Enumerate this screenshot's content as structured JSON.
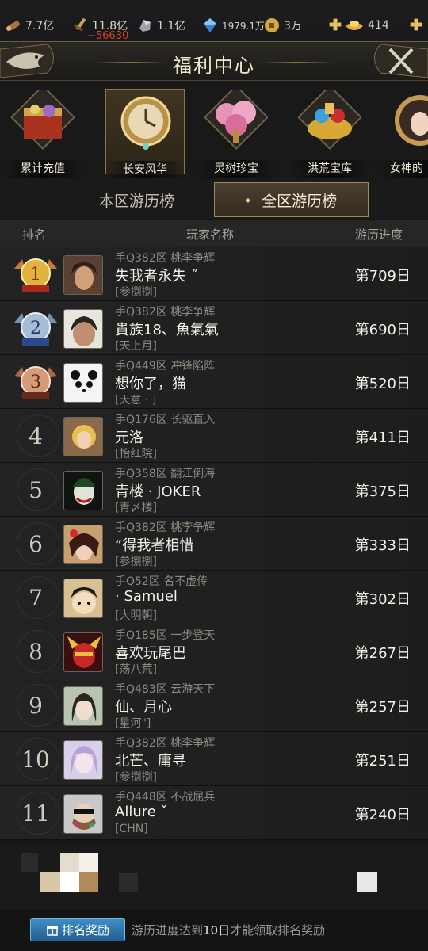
{
  "resources": {
    "wood": "7.7亿",
    "weapon": "11.8亿",
    "weapon_delta": "−56630",
    "iron": "1.1亿",
    "gem": "1979.1万",
    "coin": "3万",
    "ingot": "414"
  },
  "title": "福利中心",
  "categories": [
    {
      "label": "累计充值",
      "icon": "treasure-chest-icon"
    },
    {
      "label": "长安风华",
      "icon": "golden-clock-icon"
    },
    {
      "label": "灵树珍宝",
      "icon": "blossom-tree-icon"
    },
    {
      "label": "洪荒宝库",
      "icon": "treasure-pile-icon"
    },
    {
      "label": "女神的",
      "icon": "goddess-portrait-icon"
    }
  ],
  "tabs": {
    "local": "本区游历榜",
    "global": "全区游历榜"
  },
  "headers": {
    "rank": "排名",
    "player": "玩家名称",
    "progress": "游历进度"
  },
  "rows": [
    {
      "rank": "1",
      "server": "手Q382区  桃李争辉",
      "name": "失我者永失 ˝",
      "guild": "[参捌捌]",
      "progress": "第709日"
    },
    {
      "rank": "2",
      "server": "手Q382区  桃李争辉",
      "name": "貴族18、魚氣氣",
      "guild": "[天上月]",
      "progress": "第690日"
    },
    {
      "rank": "3",
      "server": "手Q449区  冲锋陷阵",
      "name": "想你了，猫",
      "guild": "[天意 · ]",
      "progress": "第520日"
    },
    {
      "rank": "4",
      "server": "手Q176区  长驱直入",
      "name": "元洛",
      "guild": "[怡红院]",
      "progress": "第411日"
    },
    {
      "rank": "5",
      "server": "手Q358区  翻江倒海",
      "name": "青楼 · JOKER",
      "guild": "[青〆楼]",
      "progress": "第375日"
    },
    {
      "rank": "6",
      "server": "手Q382区  桃李争辉",
      "name": "“得我者相惜",
      "guild": "[参捌捌]",
      "progress": "第333日"
    },
    {
      "rank": "7",
      "server": "手Q52区  名不虚传",
      "name": " · Samuel",
      "guild": "[大明朝]",
      "progress": "第302日"
    },
    {
      "rank": "8",
      "server": "手Q185区  一步登天",
      "name": "喜欢玩尾巴",
      "guild": "[荡八荒]",
      "progress": "第267日"
    },
    {
      "rank": "9",
      "server": "手Q483区  云游天下",
      "name": "仙、月心",
      "guild": "[星河\"]",
      "progress": "第257日"
    },
    {
      "rank": "10",
      "server": "手Q382区  桃李争辉",
      "name": "北芒、庸寻",
      "guild": "[参捌捌]",
      "progress": "第251日"
    },
    {
      "rank": "11",
      "server": "手Q448区  不战屈兵",
      "name": "Allure ˇ",
      "guild": "[CHN]",
      "progress": "第240日"
    }
  ],
  "reward": {
    "button": "排名奖励",
    "note_prefix": "游历进度达到",
    "note_days": "10日",
    "note_suffix": "才能领取排名奖励"
  },
  "colors": {
    "accent_gold": "#a08a55",
    "reward_blue": "#2f7bb0",
    "delta_red": "#d0402a"
  }
}
